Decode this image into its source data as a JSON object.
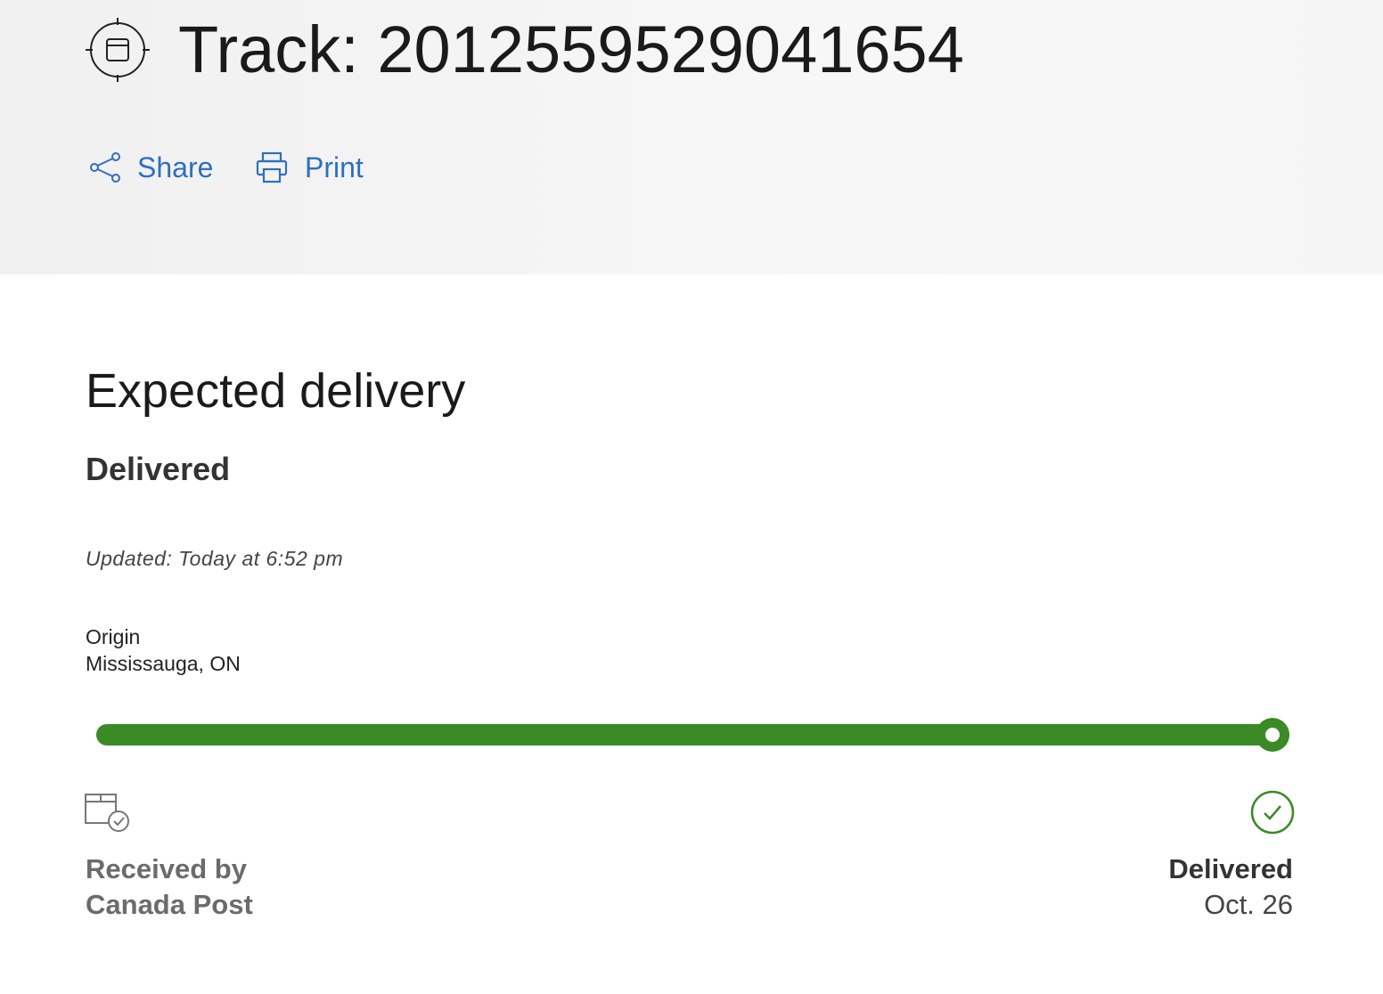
{
  "header": {
    "title": "Track: 2012559529041654",
    "share_label": "Share",
    "print_label": "Print",
    "link_color": "#2f6fbf"
  },
  "main": {
    "expected_title": "Expected delivery",
    "status": "Delivered",
    "updated": "Updated: Today at 6:52 pm",
    "origin_label": "Origin",
    "origin_value": "Mississauga, ON",
    "progress_fraction": 1.0,
    "progress_color": "#3a8a26",
    "start_step": {
      "line1": "Received by",
      "line2": "Canada Post",
      "icon": "package-check-icon"
    },
    "end_step": {
      "label": "Delivered",
      "date": "Oct. 26",
      "icon": "check-circle-icon"
    }
  }
}
